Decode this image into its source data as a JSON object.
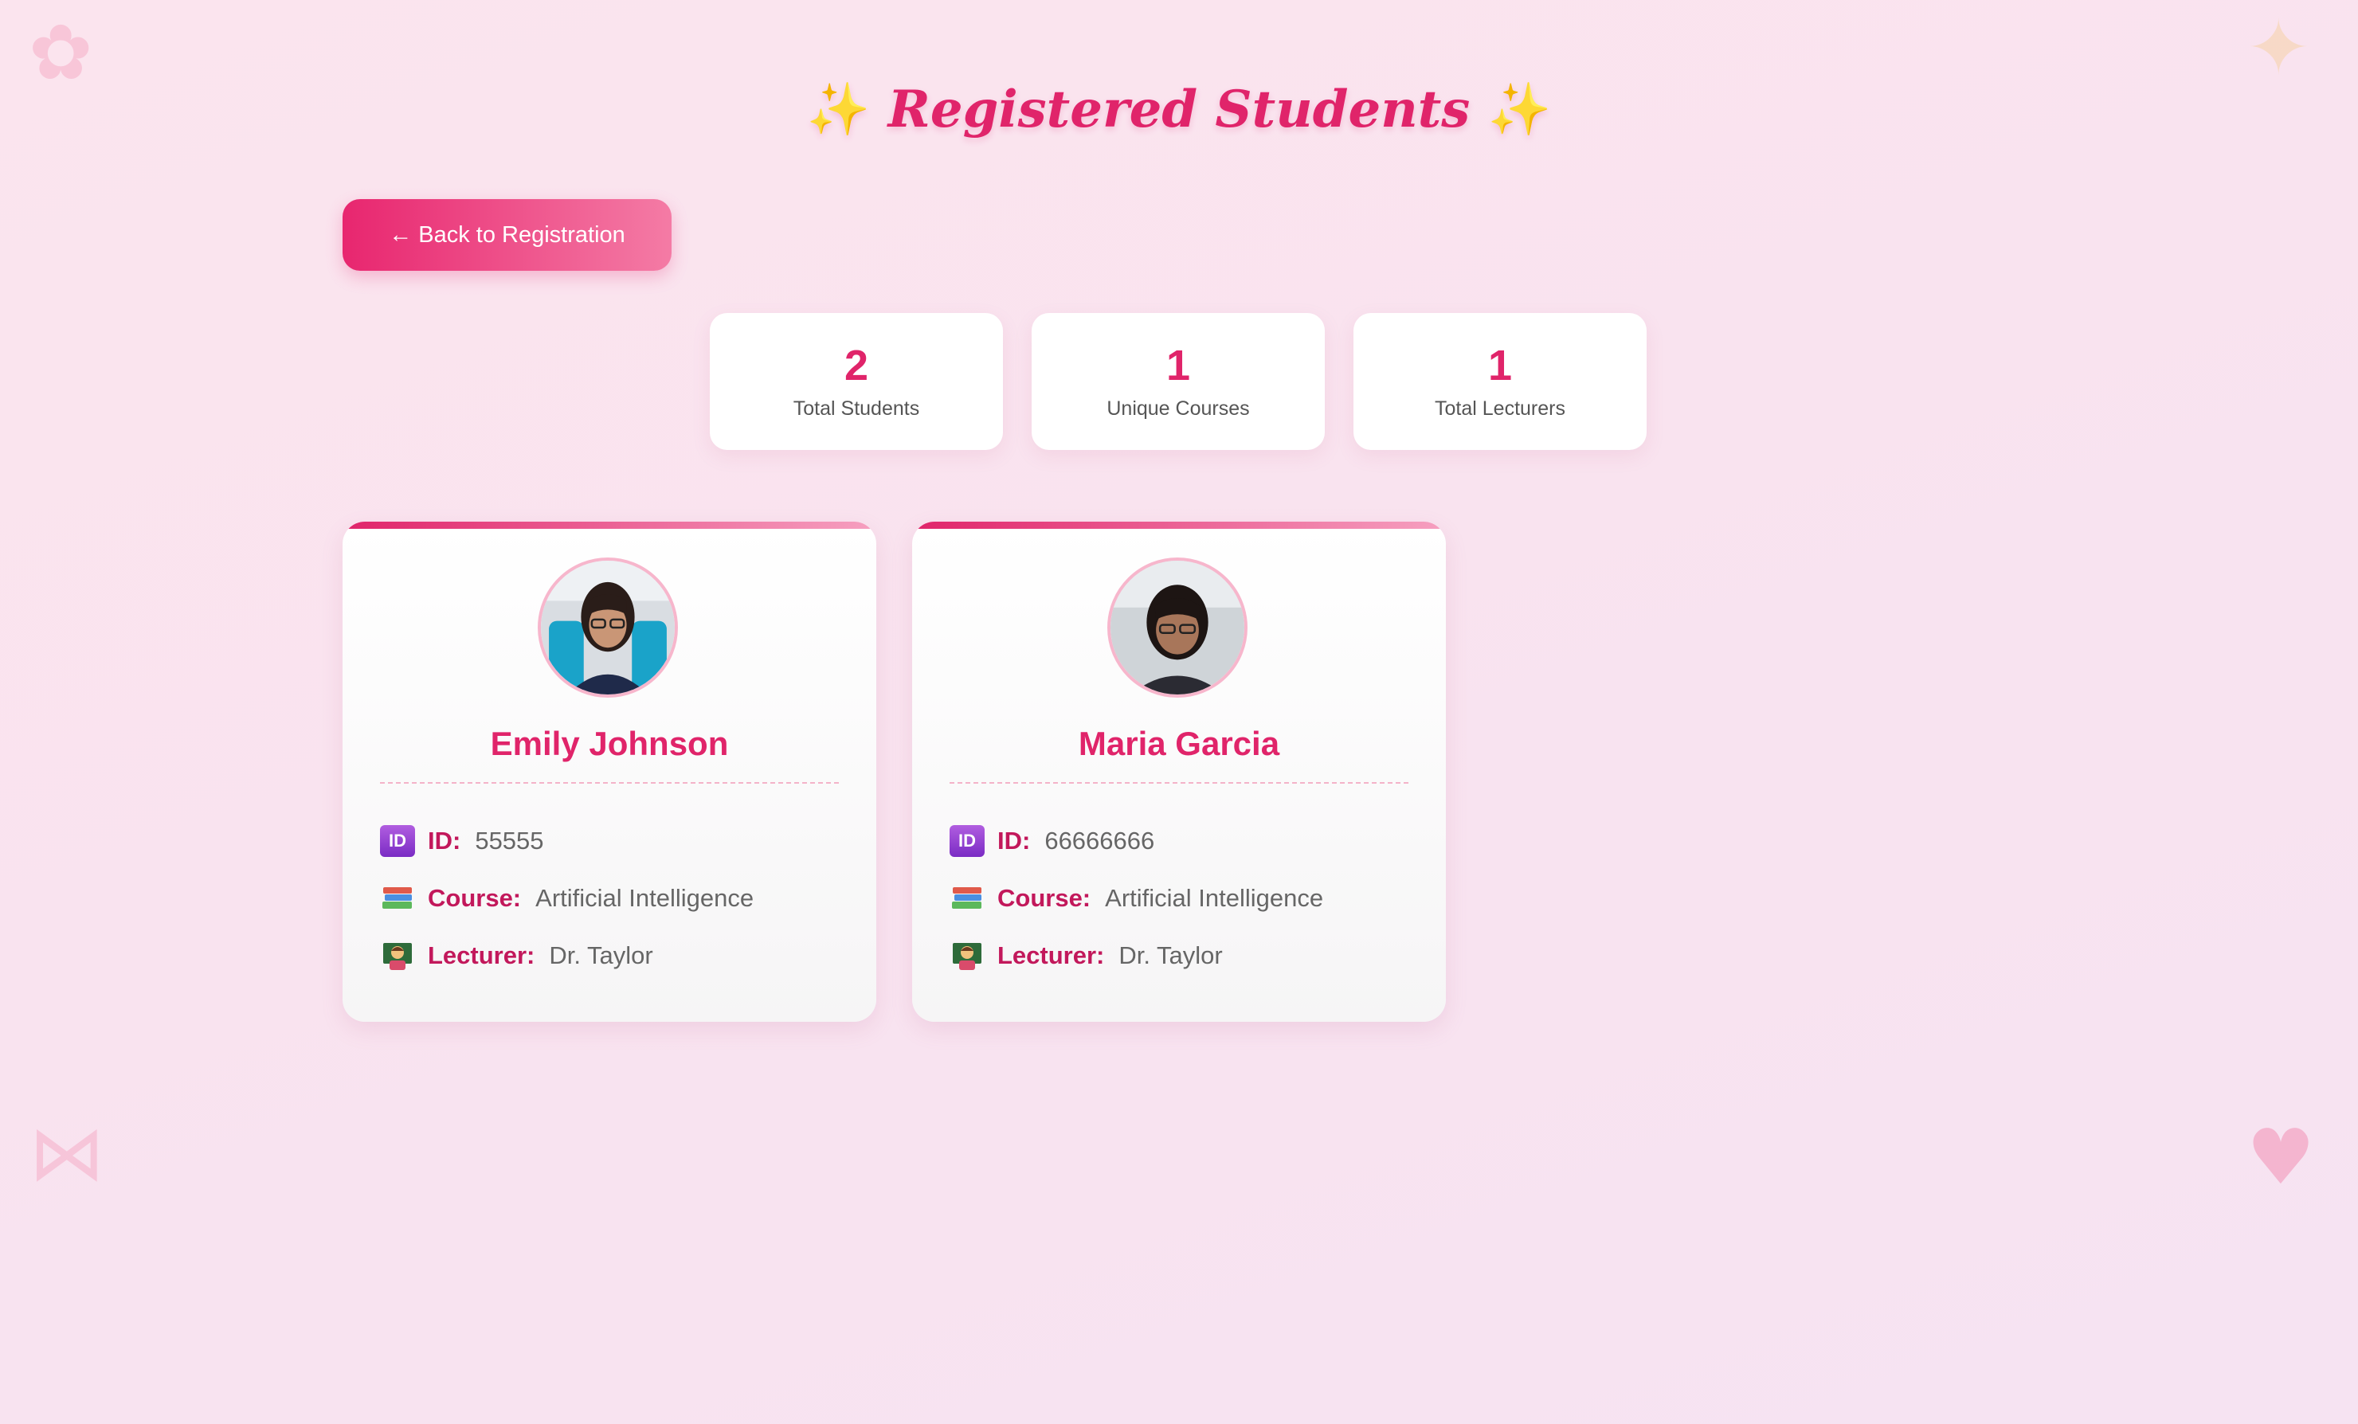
{
  "page": {
    "title": "Registered Students",
    "title_decoration": "✨"
  },
  "back_button": {
    "label": "← Back to Registration"
  },
  "stats": [
    {
      "value": "2",
      "label": "Total Students"
    },
    {
      "value": "1",
      "label": "Unique Courses"
    },
    {
      "value": "1",
      "label": "Total Lecturers"
    }
  ],
  "students": [
    {
      "name": "Emily Johnson",
      "id_label": "ID:",
      "id": "55555",
      "course_label": "Course:",
      "course": "Artificial Intelligence",
      "lecturer_label": "Lecturer:",
      "lecturer": "Dr. Taylor"
    },
    {
      "name": "Maria Garcia",
      "id_label": "ID:",
      "id": "66666666",
      "course_label": "Course:",
      "course": "Artificial Intelligence",
      "lecturer_label": "Lecturer:",
      "lecturer": "Dr. Taylor"
    }
  ],
  "icons": {
    "id": "id-badge-icon",
    "course": "books-icon",
    "lecturer": "teacher-icon",
    "corners": [
      "cherry-blossom-icon",
      "sparkles-icon",
      "ribbon-icon",
      "sparkling-heart-icon"
    ]
  },
  "colors": {
    "accent": "#e0246a",
    "label": "#c2185b",
    "background": "#fbe4ee"
  }
}
